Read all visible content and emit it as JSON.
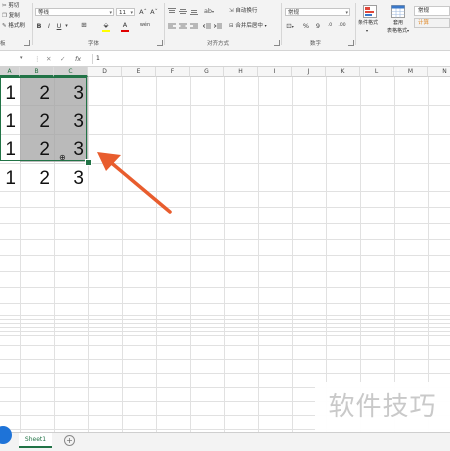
{
  "ribbon": {
    "clipboard": {
      "cut": "剪切",
      "copy": "复制",
      "format_painter": "格式刷",
      "group_label": "板"
    },
    "font": {
      "font_name": "等线",
      "font_size": "11",
      "grow": "Aˆ",
      "shrink": "Aˇ",
      "bold": "B",
      "italic": "I",
      "underline": "U",
      "wen": "wén",
      "group_label": "字体"
    },
    "alignment": {
      "wrap_text": "自动换行",
      "merge_center": "合并后居中",
      "group_label": "对齐方式"
    },
    "number": {
      "format": "常规",
      "percent": "%",
      "comma": "9",
      "group_label": "数字"
    },
    "styles": {
      "conditional_format": "条件格式",
      "table_format_line1": "套用",
      "table_format_line2": "表格格式",
      "style_normal": "常规",
      "style_calc": "计算"
    }
  },
  "formula_bar": {
    "fx": "fx",
    "value": "1"
  },
  "columns": [
    "A",
    "B",
    "C",
    "D",
    "E",
    "F",
    "G",
    "H",
    "I",
    "J",
    "K",
    "L",
    "M",
    "N"
  ],
  "rows": [
    [
      "1",
      "2",
      "3"
    ],
    [
      "1",
      "2",
      "3"
    ],
    [
      "1",
      "2",
      "3"
    ],
    [
      "1",
      "2",
      "3"
    ]
  ],
  "sheet_tabs": [
    "Sheet1"
  ],
  "annotation": {
    "arrow_color": "#e85d2e"
  },
  "watermark": "软件技巧",
  "colors": {
    "accent": "#217346",
    "selection": "#a0a0a0",
    "arrow": "#e85d2e"
  }
}
